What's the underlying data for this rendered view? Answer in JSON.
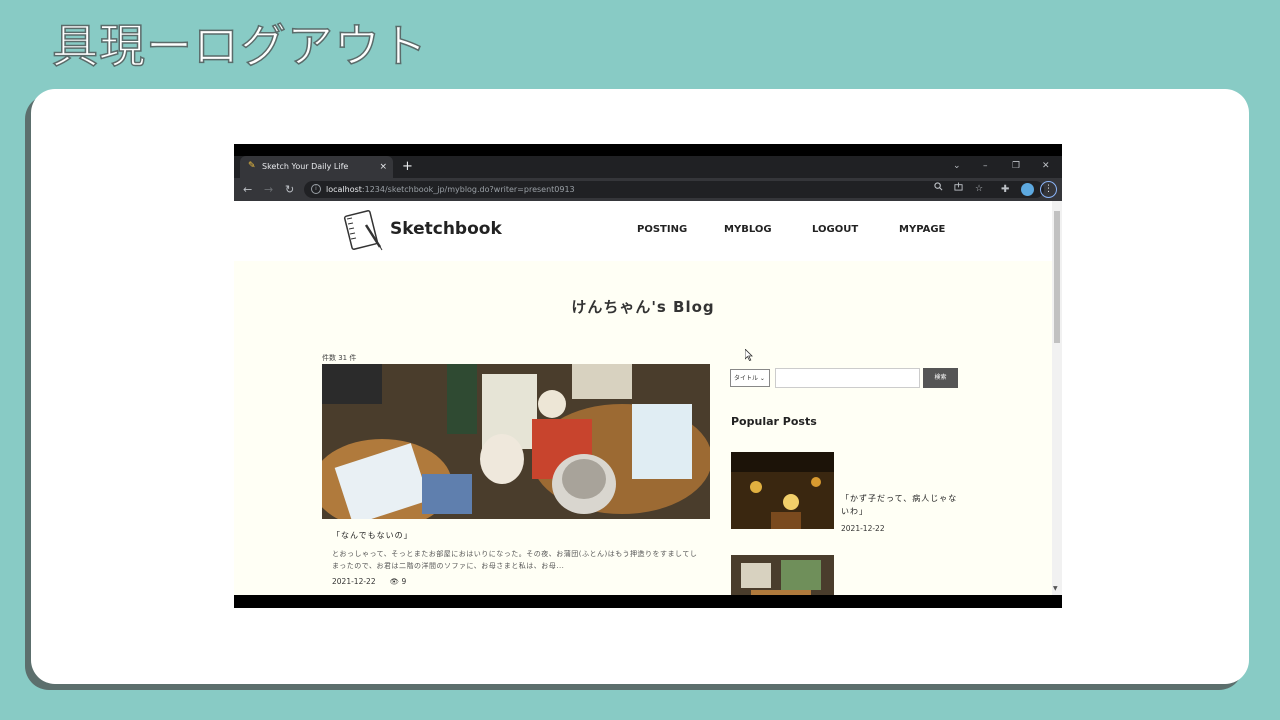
{
  "slide": {
    "title": "具現ーログアウト"
  },
  "browser": {
    "tab_title": "Sketch Your Daily Life",
    "tab_close": "×",
    "new_tab": "+",
    "window_controls": [
      "⌄",
      "–",
      "❐",
      "✕"
    ],
    "nav_icons": [
      "←",
      "→",
      "↻"
    ],
    "url_host": "localhost",
    "url_rest": ":1234/sketchbook_jp/myblog.do?writer=present0913",
    "omnibox_icons": [
      "search-icon",
      "share-icon",
      "star-icon",
      "extensions-icon"
    ],
    "menu_icon": "⋮"
  },
  "site": {
    "logo_text": "Sketchbook",
    "menu": [
      "POSTING",
      "MYBLOG",
      "LOGOUT",
      "MYPAGE"
    ]
  },
  "blog": {
    "title": "けんちゃん's Blog",
    "count": "件数 31 件",
    "post": {
      "title": "「なんでもないの」",
      "excerpt": "とおっしゃって、そっとまたお部屋におはいりになった。その夜、お蒲団(ふとん)はもう押造りをすましてしまったので、お君は二階の洋間のソファに、お母さまと私は、お母...",
      "date": "2021-12-22",
      "views": "9"
    }
  },
  "sidebar": {
    "search_select": "タイトル ⌄",
    "search_button": "検索",
    "popular_title": "Popular Posts",
    "popular": [
      {
        "title": "「かず子だって、病人じゃないわ」",
        "date": "2021-12-22"
      }
    ]
  },
  "colors": {
    "background": "#88cbc5",
    "page_bg": "#fffff5",
    "search_button": "#555555"
  }
}
